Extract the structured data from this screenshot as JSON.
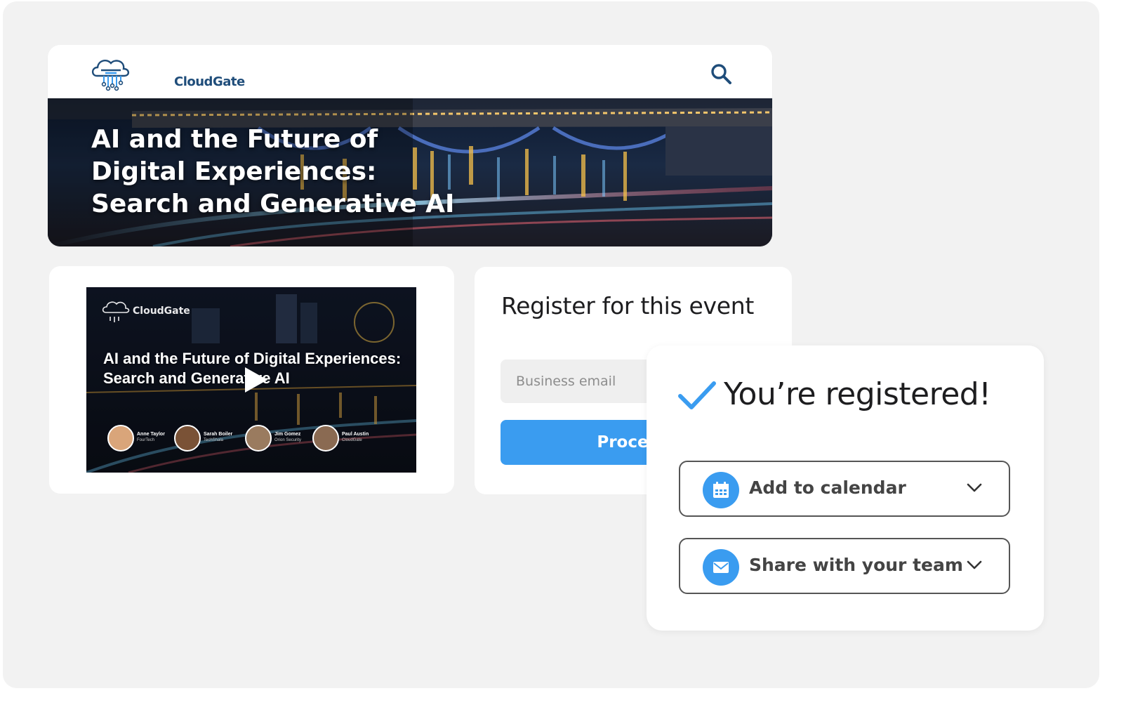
{
  "brand": {
    "name": "CloudGate",
    "accent": "#3a9cf0",
    "dark_blue": "#1f4d7a"
  },
  "header": {
    "search_icon": "search-icon"
  },
  "banner": {
    "title": "AI and the Future of\nDigital Experiences:\nSearch and Generative AI"
  },
  "video": {
    "logo_text": "CloudGate",
    "title": "AI and the Future of Digital Experiences:\nSearch and Generative AI",
    "play_icon": "play-icon",
    "speakers": [
      {
        "name": "Anne Taylor",
        "org": "FourTech"
      },
      {
        "name": "Sarah Boiler",
        "org": "TechShala"
      },
      {
        "name": "Jim Gomez",
        "org": "Orion Security"
      },
      {
        "name": "Paul Austin",
        "org": "CloudGate"
      }
    ]
  },
  "register": {
    "title": "Register for this event",
    "email_placeholder": "Business email",
    "proceed_label": "Proceed"
  },
  "confirmation": {
    "title": "You’re registered!",
    "calendar_label": "Add to calendar",
    "share_label": "Share with your team"
  }
}
